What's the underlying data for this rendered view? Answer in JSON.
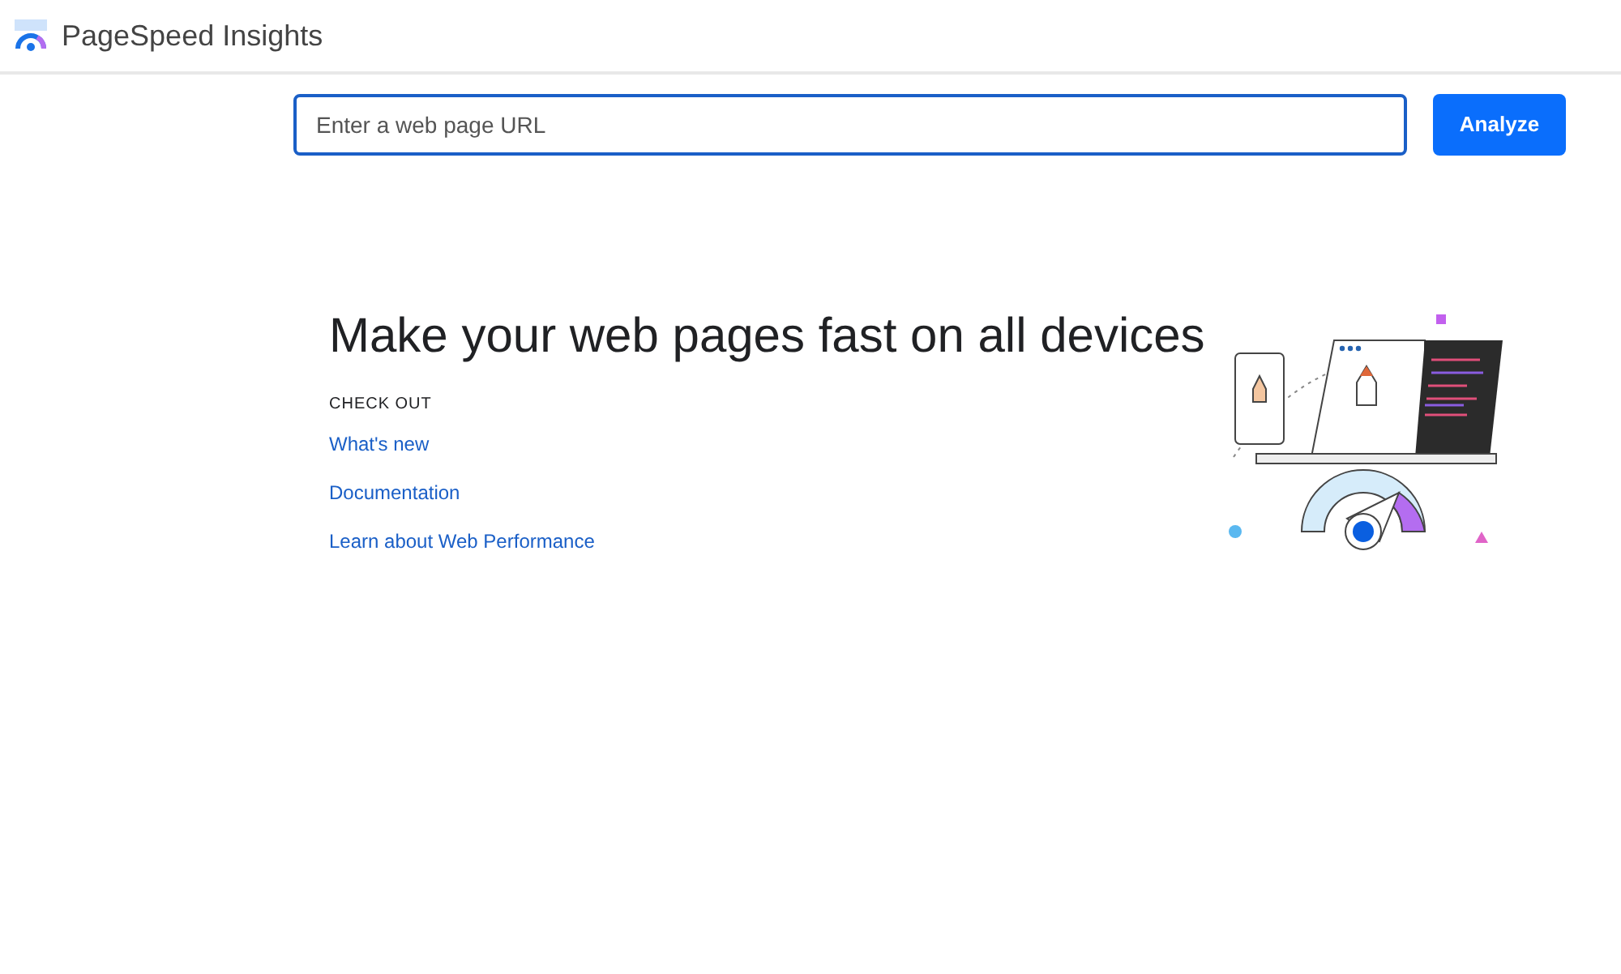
{
  "header": {
    "title": "PageSpeed Insights"
  },
  "search": {
    "placeholder": "Enter a web page URL",
    "button": "Analyze"
  },
  "hero": {
    "heading": "Make your web pages fast on all devices",
    "section_label": "CHECK OUT",
    "links": [
      "What's new",
      "Documentation",
      "Learn about Web Performance"
    ]
  }
}
